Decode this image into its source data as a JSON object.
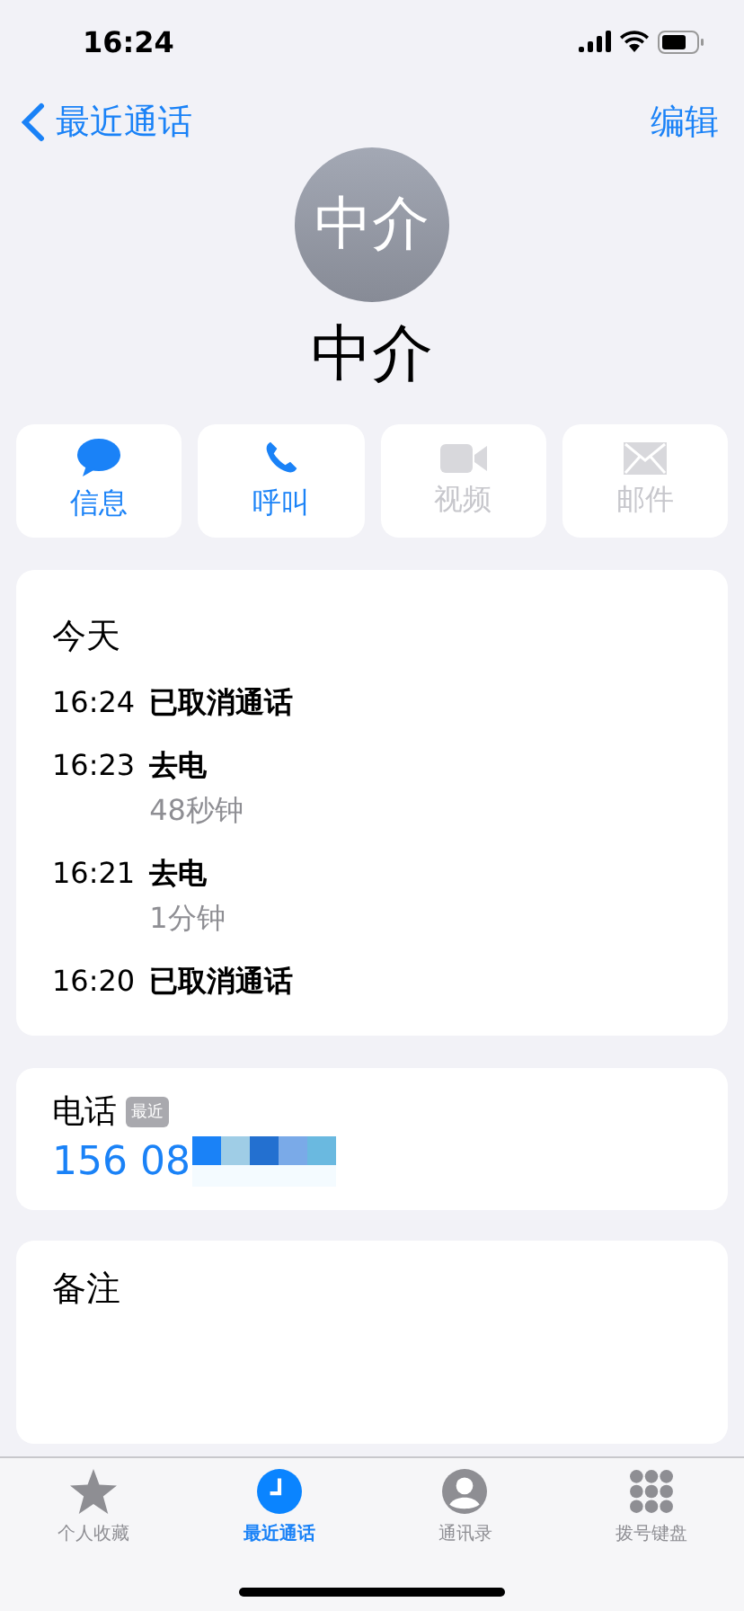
{
  "status_bar": {
    "time": "16:24"
  },
  "nav": {
    "back": "最近通话",
    "edit": "编辑"
  },
  "contact": {
    "initials": "中介",
    "name": "中介"
  },
  "actions": [
    {
      "kind": "message",
      "label": "信息",
      "enabled": true
    },
    {
      "kind": "call",
      "label": "呼叫",
      "enabled": true
    },
    {
      "kind": "video",
      "label": "视频",
      "enabled": false
    },
    {
      "kind": "mail",
      "label": "邮件",
      "enabled": false
    }
  ],
  "recents": {
    "heading": "今天",
    "calls": [
      {
        "time": "16:24",
        "status": "已取消通话"
      },
      {
        "time": "16:23",
        "status": "去电",
        "duration": "48秒钟"
      },
      {
        "time": "16:21",
        "status": "去电",
        "duration": "1分钟"
      },
      {
        "time": "16:20",
        "status": "已取消通话"
      }
    ]
  },
  "phone": {
    "label": "电话",
    "badge": "最近",
    "number": "156 08"
  },
  "notes": {
    "label": "备注"
  },
  "tab_bar": [
    {
      "kind": "favorites",
      "label": "个人收藏",
      "selected": false
    },
    {
      "kind": "recents",
      "label": "最近通话",
      "selected": true
    },
    {
      "kind": "contacts",
      "label": "通讯录",
      "selected": false
    },
    {
      "kind": "keypad",
      "label": "拨号键盘",
      "selected": false
    }
  ]
}
